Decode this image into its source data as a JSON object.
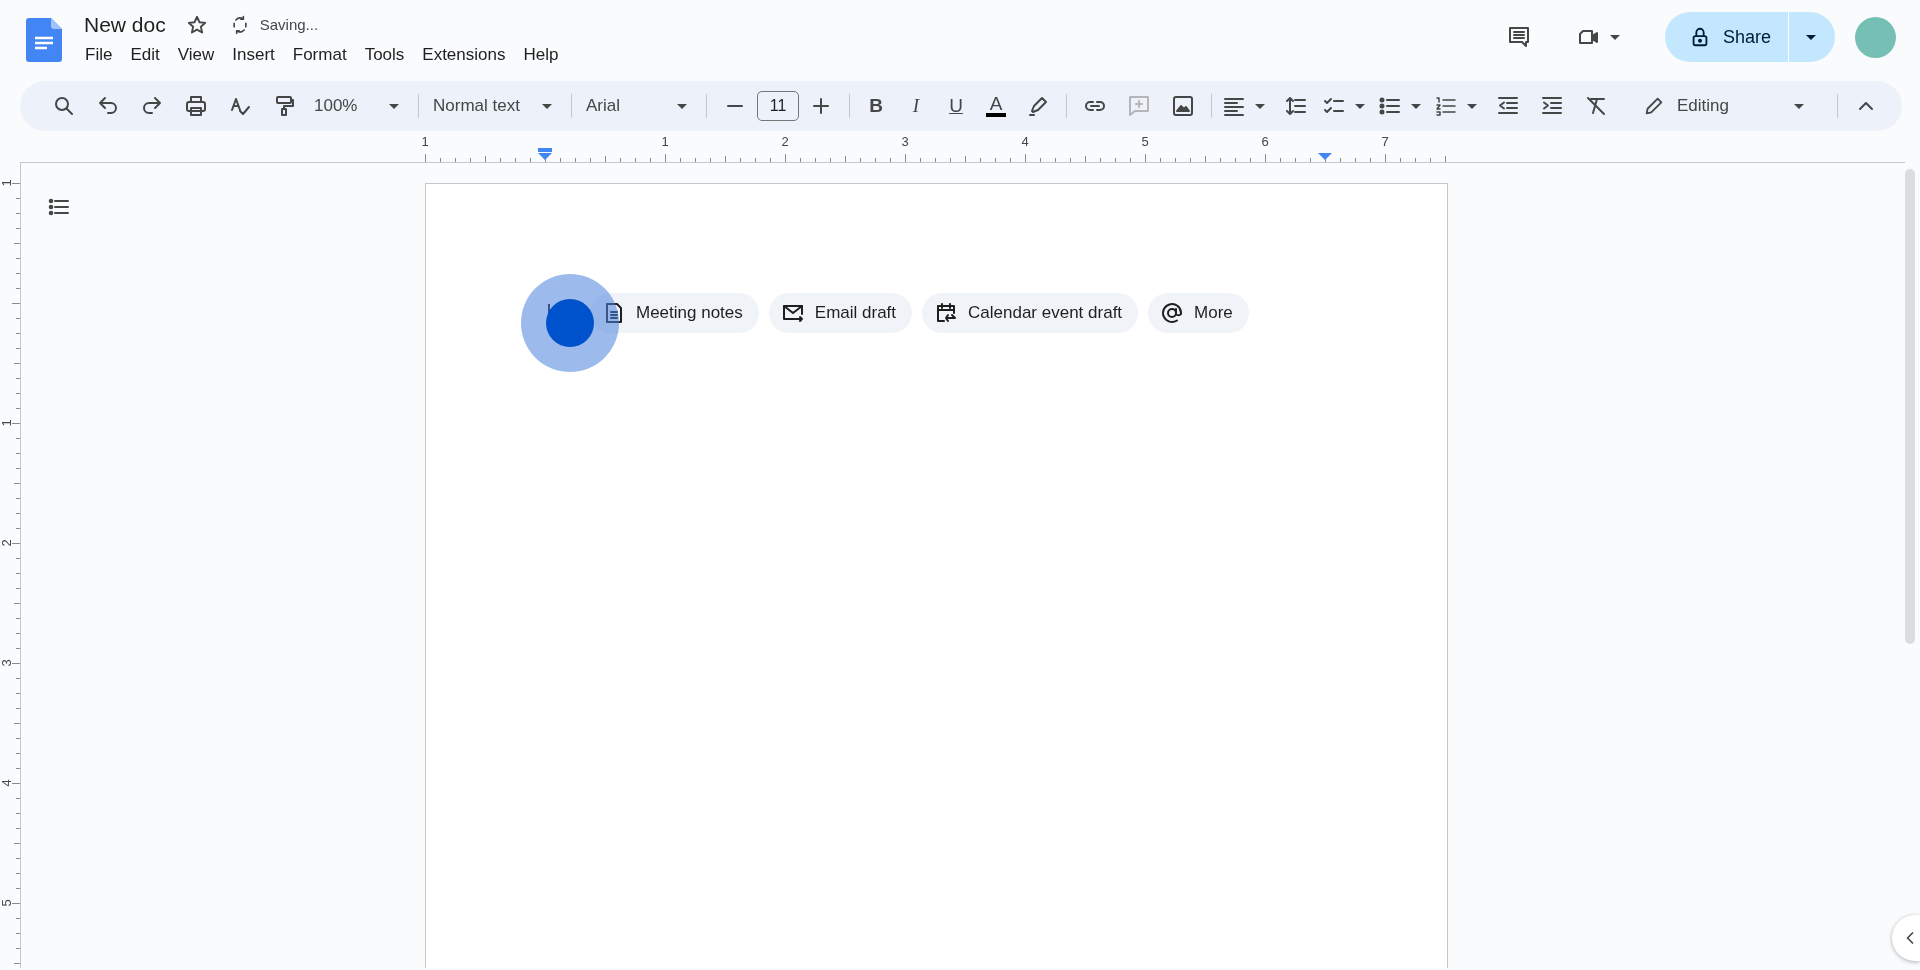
{
  "document": {
    "title": "New doc",
    "starred": false,
    "save_status": "Saving..."
  },
  "menu": [
    "File",
    "Edit",
    "View",
    "Insert",
    "Format",
    "Tools",
    "Extensions",
    "Help"
  ],
  "toolbar": {
    "zoom": "100%",
    "paragraph_style": "Normal text",
    "font": "Arial",
    "font_size": "11",
    "format_buttons": [
      {
        "label": "B",
        "kind": "bold"
      },
      {
        "label": "I",
        "kind": "italic"
      },
      {
        "label": "U",
        "kind": "underline"
      },
      {
        "label": "A",
        "kind": "text-color"
      }
    ],
    "add_comment_disabled": true,
    "mode": "Editing"
  },
  "share_button": "Share",
  "ruler": {
    "horizontal": [
      "1",
      "1",
      "2",
      "3",
      "4",
      "5",
      "6",
      "7"
    ],
    "vertical": [
      "1",
      "1",
      "2",
      "3",
      "4",
      "5"
    ]
  },
  "chips": [
    {
      "label": "Meeting notes",
      "kind": "document"
    },
    {
      "label": "Email draft",
      "kind": "email"
    },
    {
      "label": "Calendar event draft",
      "kind": "calendar"
    },
    {
      "label": "More",
      "kind": "at"
    }
  ]
}
